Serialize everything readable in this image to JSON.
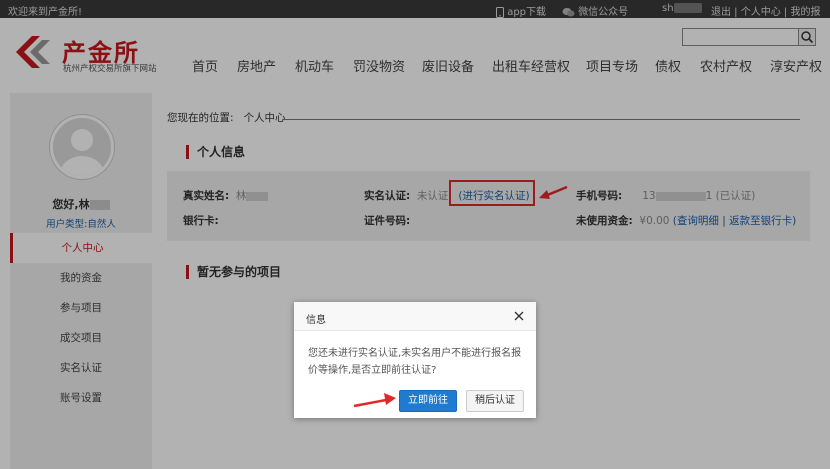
{
  "topbar": {
    "welcome": "欢迎来到产金所!",
    "app_download": "app下载",
    "wechat": "微信公众号",
    "user_prefix": "sh",
    "logout": "退出",
    "sep": " | ",
    "personal_center": "个人中心",
    "my_registration": "我的报名"
  },
  "logo": {
    "name": "产金所",
    "subtitle": "杭州产权交易所旗下网站"
  },
  "nav": [
    "首页",
    "房地产",
    "机动车",
    "罚没物资",
    "废旧设备",
    "出租车经营权",
    "项目专场",
    "债权",
    "农村产权",
    "淳安产权"
  ],
  "sidebar": {
    "greeting": "您好,林",
    "user_type_label": "用户类型:",
    "user_type": "自然人",
    "menu": [
      "个人中心",
      "我的资金",
      "参与项目",
      "成交项目",
      "实名认证",
      "账号设置"
    ]
  },
  "breadcrumb": {
    "label": "您现在的位置:",
    "current": "个人中心"
  },
  "personal_info": {
    "title": "个人信息",
    "real_name_label": "真实姓名:",
    "real_name_value": "林",
    "bank_card_label": "银行卡:",
    "verification_label": "实名认证:",
    "verification_status": "未认证",
    "verify_link": "(进行实名认证)",
    "id_number_label": "证件号码:",
    "phone_label": "手机号码:",
    "phone_prefix": "13",
    "phone_suffix": "1",
    "phone_status": "(已认证)",
    "funds_label": "未使用资金:",
    "funds_value": "¥0.00",
    "funds_details": "查询明细",
    "funds_sep": " | ",
    "funds_return": "返款至银行卡",
    "paren_open": "(",
    "paren_close": ")"
  },
  "projects": {
    "title": "暂无参与的项目"
  },
  "dialog": {
    "title": "信息",
    "message": "您还未进行实名认证,未实名用户不能进行报名报价等操作,是否立即前往认证?",
    "confirm": "立即前往",
    "later": "稍后认证"
  },
  "colors": {
    "brand_red": "#c8171e",
    "link_blue": "#1a5ea8",
    "primary_button": "#1e7bd0",
    "annotation_red": "#e0292b"
  }
}
